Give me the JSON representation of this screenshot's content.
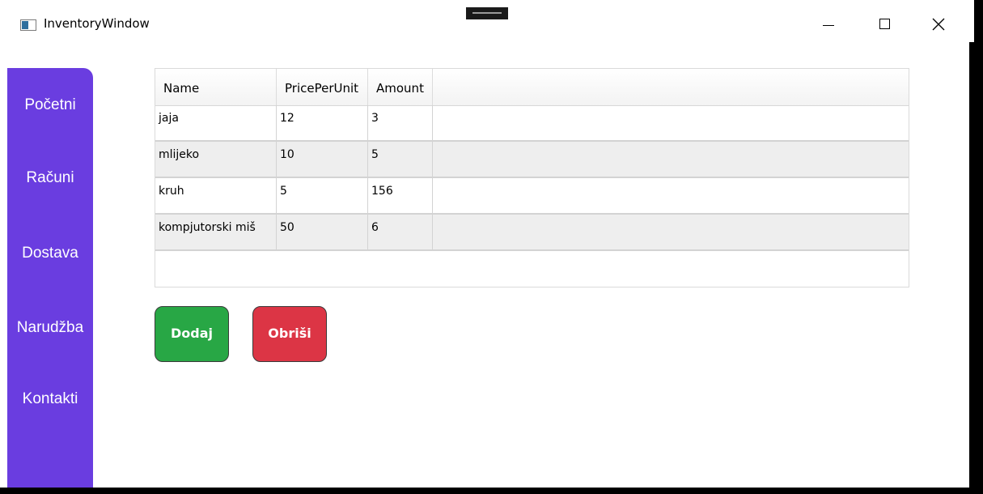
{
  "window": {
    "title": "InventoryWindow"
  },
  "sidebar": {
    "items": [
      {
        "label": "Početni"
      },
      {
        "label": "Računi"
      },
      {
        "label": "Dostava"
      },
      {
        "label": "Narudžba"
      },
      {
        "label": "Kontakti"
      }
    ]
  },
  "grid": {
    "columns": [
      "Name",
      "PricePerUnit",
      "Amount"
    ],
    "rows": [
      [
        "jaja",
        "12",
        "3"
      ],
      [
        "mlijeko",
        "10",
        "5"
      ],
      [
        "kruh",
        "5",
        "156"
      ],
      [
        "kompjutorski miš",
        "50",
        "6"
      ]
    ]
  },
  "buttons": {
    "add": "Dodaj",
    "delete": "Obriši"
  },
  "colors": {
    "sidebar": "#6a3de0",
    "add_button": "#28a745",
    "delete_button": "#dc3545"
  },
  "icons": {
    "app": "app-window-icon",
    "minimize": "minimize-icon",
    "maximize": "maximize-icon",
    "close": "close-icon"
  }
}
